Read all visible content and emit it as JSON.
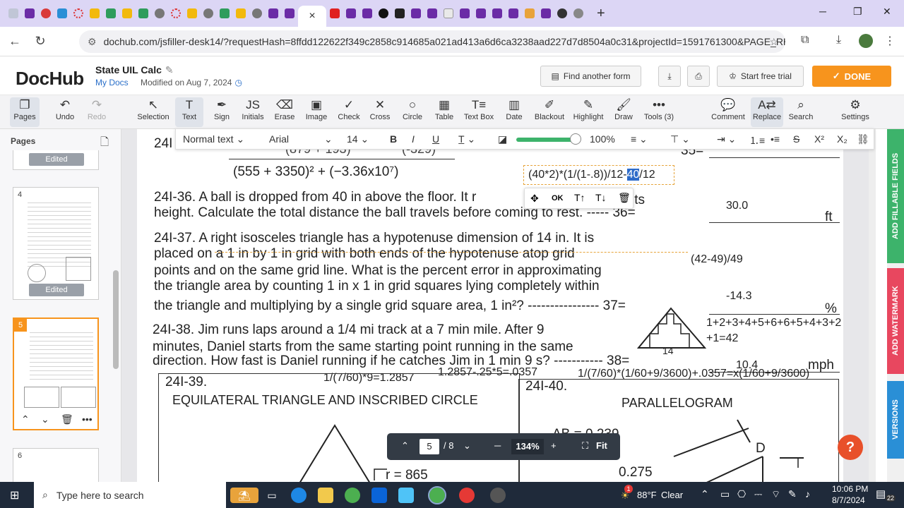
{
  "browser": {
    "url": "dochub.com/jsfiller-desk14/?requestHash=8ffdd122622f349c2858c914685a021ad413a6d6ca3238aad227d7d8504a0c31&projectId=1591761300&PAGE_REARR...",
    "new_tab_glyph": "+",
    "close_tab_glyph": "×",
    "minimize": "─",
    "maximize": "❐",
    "close": "✕"
  },
  "header": {
    "logo": "DocHub",
    "title": "State UIL Calc",
    "breadcrumb": "My Docs",
    "modified": "Modified on Aug 7, 2024",
    "find_form": "Find another form",
    "free_trial": "Start free trial",
    "done": "DONE"
  },
  "toolbar": {
    "pages": "Pages",
    "undo": "Undo",
    "redo": "Redo",
    "selection": "Selection",
    "text": "Text",
    "sign": "Sign",
    "initials": "Initials",
    "erase": "Erase",
    "image": "Image",
    "check": "Check",
    "cross": "Cross",
    "circle": "Circle",
    "table": "Table",
    "textbox": "Text Box",
    "date": "Date",
    "blackout": "Blackout",
    "highlight": "Highlight",
    "draw": "Draw",
    "tools": "Tools (3)",
    "comment": "Comment",
    "replace": "Replace",
    "search": "Search",
    "settings": "Settings"
  },
  "format_bar": {
    "style": "Normal text",
    "font": "Arial",
    "size": "14",
    "opacity": "100%"
  },
  "sidebar": {
    "header": "Pages",
    "thumbs": [
      {
        "num": "",
        "badge": "Edited"
      },
      {
        "num": "4",
        "badge": "Edited"
      },
      {
        "num": "5",
        "badge": ""
      },
      {
        "num": "6",
        "badge": ""
      }
    ]
  },
  "document": {
    "q35_label": "24I",
    "q35_num": "35=",
    "q35_numer": "(879 + 193)",
    "q35_numer2": "(-329)",
    "q35_expr": "(555 + 3350)² + (−3.36x10⁷)",
    "edit_box": "(40*2)*(1/(1-.8))/12-",
    "edit_sel": "40",
    "edit_tail": "/12",
    "q36_line1": "24I-36. A ball is dropped from 40 in above the floor. It r",
    "q36_line1_end": "its",
    "q36_line2": "height. Calculate the total distance the ball travels before coming to rest. ----- 36=",
    "q36_ans": "30.0",
    "q36_unit": "ft",
    "q37_line1": "24I-37. A right isosceles triangle has a hypotenuse dimension of 14 in. It is",
    "q37_line2": "placed on a 1 in by 1 in grid with both ends of the hypotenuse atop grid",
    "q37_line3": "points and on the same grid line. What is the percent error in approximating",
    "q37_line4": "the triangle area by counting 1 in x 1 in grid squares lying completely within",
    "q37_line5": "the triangle and multiplying by a single grid square area, 1 in²? ---------------- 37=",
    "q37_work": "(42-49)/49",
    "q37_ans": "-14.3",
    "q37_unit": "%",
    "q37_sum1": "1+2+3+4+5+6+6+5+4+3+2",
    "q37_sum2": "+1=42",
    "q37_14": "14",
    "q38_line1": "24I-38. Jim runs laps around a 1/4 mi track at a 7 min mile. After 9",
    "q38_line2": "minutes, Daniel starts from the same starting point running in the same",
    "q38_line3": "direction. How fast is Daniel running if he catches Jim in 1 min 9 s? ----------- 38=",
    "q38_ans": "10.4",
    "q38_unit": "mph",
    "w1": "1/(7/60)*9=1.2857",
    "w2": "1.2857-.25*5=.0357",
    "w3": "1/(7/60)*(1/60+9/3600)+.0357=x(1/60+9/3600)",
    "q39_title": "24I-39.",
    "q39_sub": "EQUILATERAL TRIANGLE AND INSCRIBED CIRCLE",
    "q39_r": "r = 865",
    "q40_title": "24I-40.",
    "q40_sub": "PARALLELOGRAM",
    "q40_ab": "AB = 0.239",
    "q40_val": "0.275",
    "q40_d": "D"
  },
  "popup": {
    "ok": "OK"
  },
  "right_tabs": {
    "fillable": "ADD FILLABLE FIELDS",
    "watermark": "ADD WATERMARK",
    "versions": "VERSIONS"
  },
  "zoom": {
    "page": "5",
    "total": "/ 8",
    "zoom": "134%",
    "fit": "Fit"
  },
  "taskbar": {
    "search": "Type here to search",
    "temp": "88°F",
    "weather": "Clear",
    "time": "10:06 PM",
    "date": "8/7/2024",
    "notif": "22",
    "badge": "1"
  },
  "colors": {
    "accent": "#f7941d",
    "link": "#2a6fc9",
    "fillable": "#3db36b",
    "watermark": "#e8475f",
    "versions": "#2a8fd6"
  }
}
